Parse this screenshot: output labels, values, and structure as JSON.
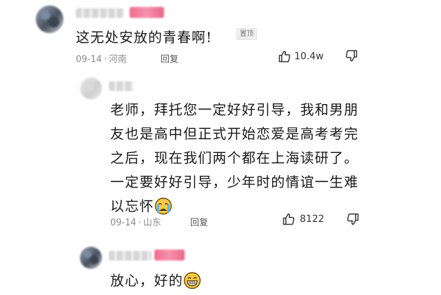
{
  "comments": [
    {
      "text": "这无处安放的青春啊!",
      "badge": "置顶",
      "date": "09-14",
      "sep": "·",
      "location": "河南",
      "reply_label": "回复",
      "likes": "10.4w"
    },
    {
      "text": "老师，拜托您一定好好引导，我和男朋友也是高中但正式开始恋爱是高考考完之后，现在我们两个都在上海读研了。一定要好好引导，少年时的情谊一生难以忘怀",
      "emoji": "crying-face",
      "date": "09-14",
      "sep": "·",
      "location": "山东",
      "reply_label": "回复",
      "likes": "8122"
    },
    {
      "text": "放心，好的",
      "emoji": "grinning-face"
    }
  ],
  "colors": {
    "pink_name": "#f06c92",
    "meta_gray": "#8a8a8a",
    "emoji_yellow": "#f6c944"
  }
}
